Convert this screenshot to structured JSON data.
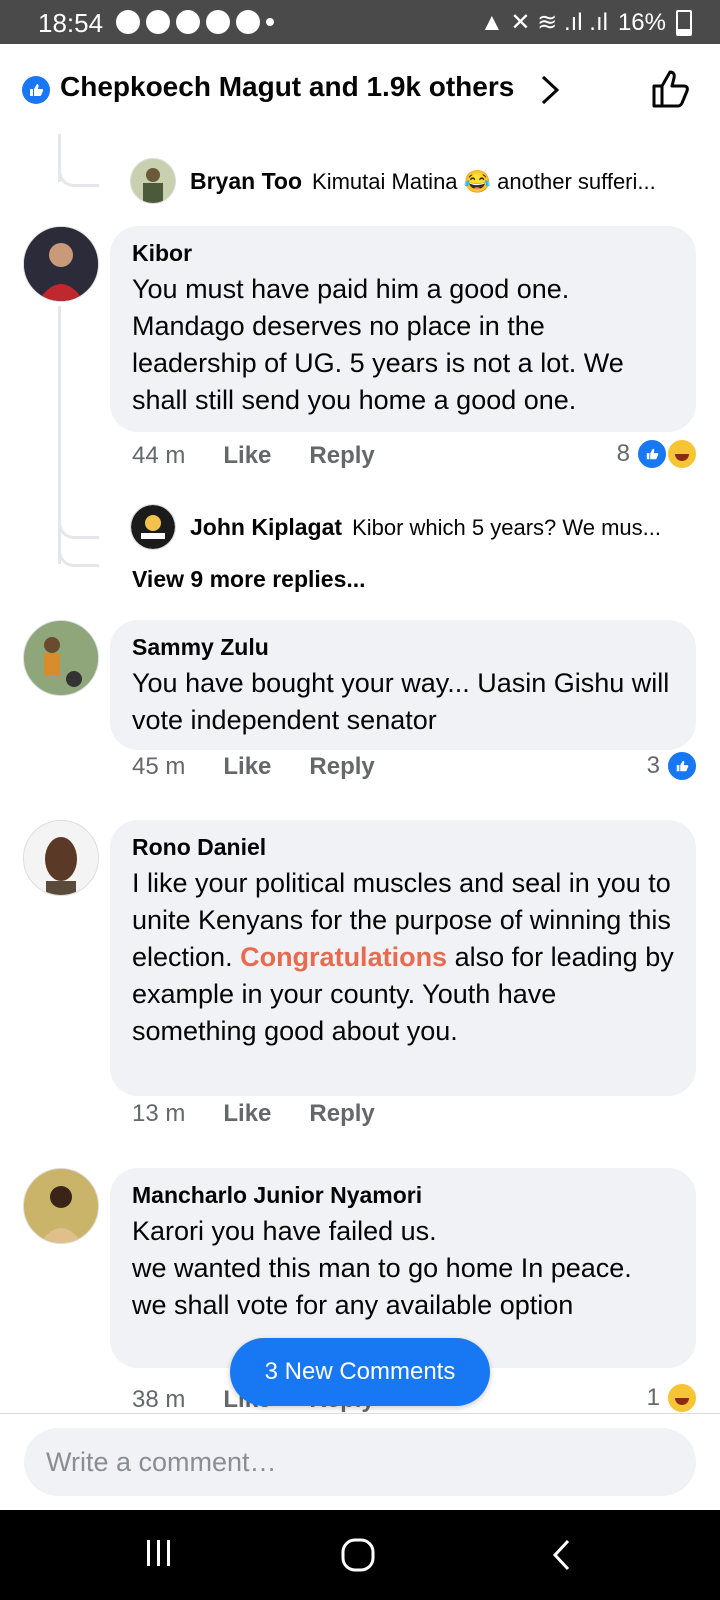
{
  "status_bar": {
    "time": "18:54",
    "battery": "16%"
  },
  "header": {
    "title": "Chepkoech Magut and 1.9k others"
  },
  "top_reply": {
    "name": "Bryan Too",
    "text": "Kimutai Matina 😂 another sufferi..."
  },
  "comments": [
    {
      "name": "Kibor",
      "text": "You must have paid him a good one. Mandago deserves no place in the leadership of UG. 5 years is not a lot. We shall still send you home a good one.",
      "time": "44 m",
      "like": "Like",
      "reply": "Reply",
      "reaction_count": "8",
      "reply_preview": {
        "name": "John Kiplagat",
        "text": "Kibor which 5 years? We mus..."
      },
      "view_more": "View 9 more replies..."
    },
    {
      "name": "Sammy Zulu",
      "text": "You have bought your way... Uasin Gishu will vote independent senator",
      "time": "45 m",
      "like": "Like",
      "reply": "Reply",
      "reaction_count": "3"
    },
    {
      "name": "Rono Daniel",
      "text_before": "I like your political muscles and seal in you to unite Kenyans for the purpose of winning this election. ",
      "highlight": "Congratulations",
      "text_after": " also for leading by example in your county. Youth have something good about you.",
      "time": "13 m",
      "like": "Like",
      "reply": "Reply"
    },
    {
      "name": "Mancharlo Junior Nyamori",
      "text": "Karori you have failed us.\nwe wanted this man to go home In peace.\nwe shall vote for any available option",
      "time": "38 m",
      "like": "Like",
      "reply": "Reply",
      "reaction_count": "1"
    }
  ],
  "new_comments_button": "3 New Comments",
  "composer": {
    "placeholder": "Write a comment…"
  }
}
